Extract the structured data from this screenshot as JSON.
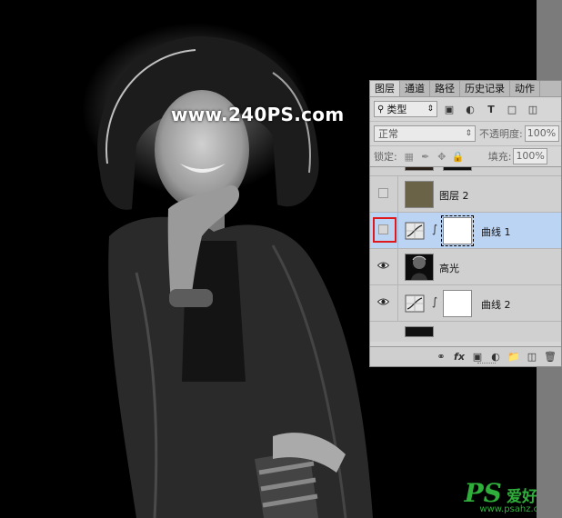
{
  "watermark": "www.240PS.com",
  "logo": {
    "ps": "PS",
    "cn": "爱好者",
    "url": "www.psahz.com"
  },
  "panel": {
    "tabs": [
      "图层",
      "通道",
      "路径",
      "历史记录",
      "动作"
    ],
    "active_tab": "图层",
    "filter_kind": "类型",
    "blend_mode": "正常",
    "opacity_label": "不透明度:",
    "opacity_value": "100%",
    "lock_label": "锁定:",
    "fill_label": "填充:",
    "fill_value": "100%",
    "layers": [
      {
        "name": "图层 2",
        "visible": false,
        "type": "color-fill",
        "color": "#6b6348"
      },
      {
        "name": "曲线 1",
        "visible": false,
        "type": "curves-adjustment",
        "selected": true,
        "highlighted": true
      },
      {
        "name": "高光",
        "visible": true,
        "type": "image"
      },
      {
        "name": "曲线 2",
        "visible": true,
        "type": "curves-adjustment"
      }
    ],
    "bottom_icons": [
      "link-icon",
      "fx-icon",
      "mask-icon",
      "adjustment-icon",
      "group-icon",
      "new-layer-icon",
      "trash-icon"
    ]
  },
  "colors": {
    "selection": "#bcd4f4",
    "highlight_box": "#e0181c",
    "logo_green": "#2fae3b",
    "layer2_fill": "#6b6348"
  }
}
